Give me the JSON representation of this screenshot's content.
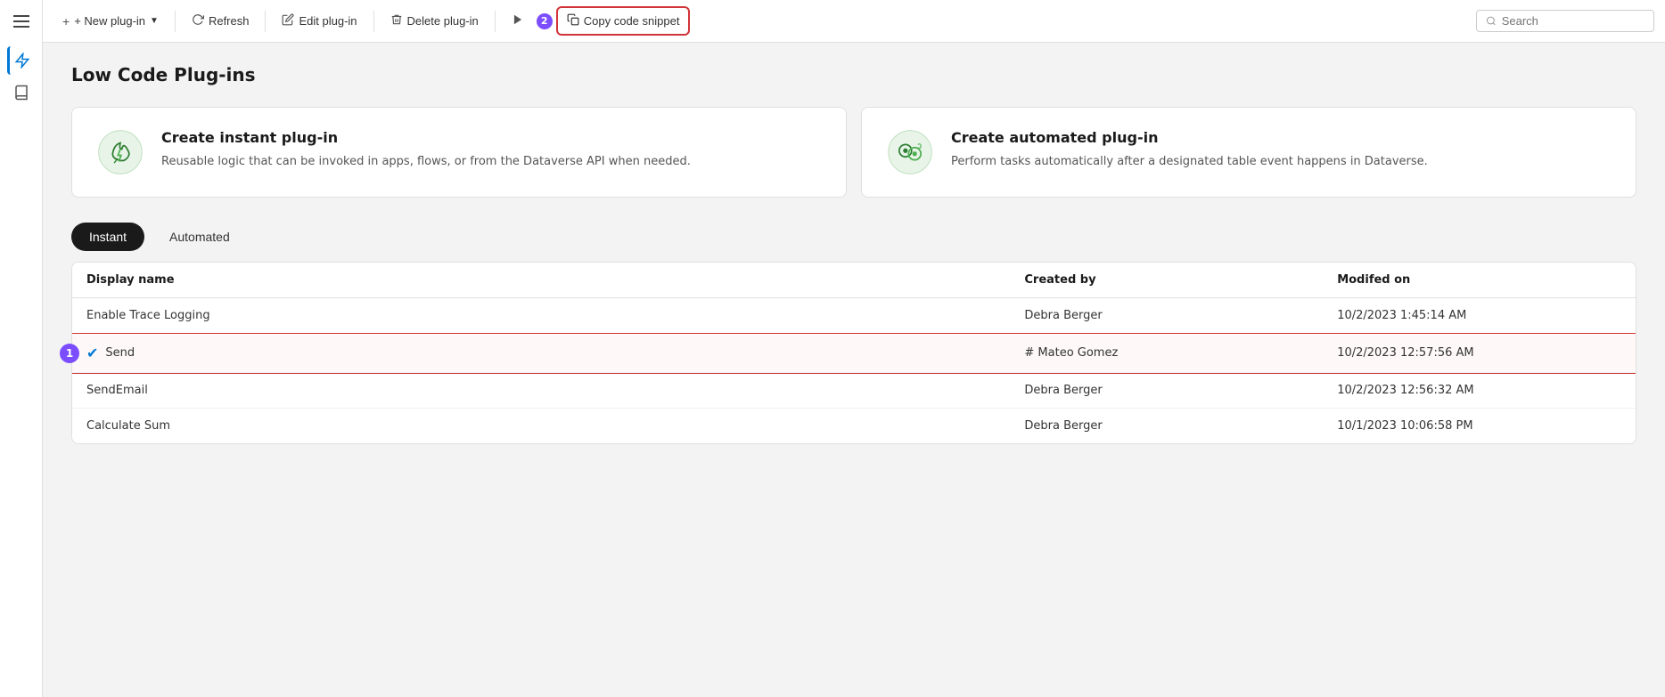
{
  "sidebar": {
    "hamburger_label": "Menu",
    "icons": [
      {
        "name": "lightning-icon",
        "symbol": "⚡"
      },
      {
        "name": "book-icon",
        "symbol": "📖"
      }
    ]
  },
  "toolbar": {
    "new_plugin_label": "+ New plug-in",
    "new_plugin_dropdown": true,
    "refresh_label": "Refresh",
    "edit_label": "Edit plug-in",
    "delete_label": "Delete plug-in",
    "run_label": "▶",
    "copy_snippet_label": "Copy code snippet",
    "copy_snippet_badge": "2",
    "search_placeholder": "Search"
  },
  "page": {
    "title": "Low Code Plug-ins"
  },
  "cards": [
    {
      "id": "instant",
      "title": "Create instant plug-in",
      "description": "Reusable logic that can be invoked in apps, flows, or from the Dataverse API when needed.",
      "icon_type": "instant"
    },
    {
      "id": "automated",
      "title": "Create automated plug-in",
      "description": "Perform tasks automatically after a designated table event happens in Dataverse.",
      "icon_type": "automated"
    }
  ],
  "tabs": [
    {
      "id": "instant",
      "label": "Instant",
      "active": true
    },
    {
      "id": "automated",
      "label": "Automated",
      "active": false
    }
  ],
  "table": {
    "columns": [
      {
        "id": "display_name",
        "label": "Display name"
      },
      {
        "id": "created_by",
        "label": "Created by"
      },
      {
        "id": "modified_on",
        "label": "Modifed on"
      }
    ],
    "rows": [
      {
        "id": "row1",
        "display_name": "Enable Trace Logging",
        "created_by": "Debra Berger",
        "modified_on": "10/2/2023 1:45:14 AM",
        "selected": false
      },
      {
        "id": "row2",
        "display_name": "Send",
        "created_by": "# Mateo Gomez",
        "modified_on": "10/2/2023 12:57:56 AM",
        "selected": true,
        "badge": "1"
      },
      {
        "id": "row3",
        "display_name": "SendEmail",
        "created_by": "Debra Berger",
        "modified_on": "10/2/2023 12:56:32 AM",
        "selected": false
      },
      {
        "id": "row4",
        "display_name": "Calculate Sum",
        "created_by": "Debra Berger",
        "modified_on": "10/1/2023 10:06:58 PM",
        "selected": false
      }
    ]
  },
  "colors": {
    "accent_blue": "#0078d4",
    "accent_purple": "#7c4dff",
    "danger_red": "#d13438",
    "selected_bg": "#fef8f8"
  }
}
